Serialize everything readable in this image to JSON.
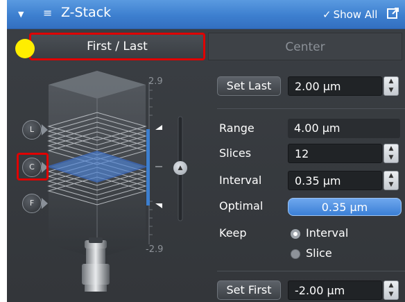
{
  "title_bar": {
    "title": "Z-Stack",
    "show_all_label": "Show All"
  },
  "tabs": {
    "first_last": "First / Last",
    "center": "Center"
  },
  "markers": {
    "last": "L",
    "center": "C",
    "first": "F"
  },
  "scale": {
    "top_value": "2.9",
    "bottom_value": "-2.9"
  },
  "set_last": {
    "label": "Set Last",
    "value": "2.00 µm"
  },
  "range": {
    "label": "Range",
    "value": "4.00 µm"
  },
  "slices": {
    "label": "Slices",
    "value": "12"
  },
  "interval": {
    "label": "Interval",
    "value": "0.35 µm"
  },
  "optimal": {
    "label": "Optimal",
    "value": "0.35 µm"
  },
  "keep": {
    "label": "Keep",
    "options": [
      "Interval",
      "Slice"
    ],
    "selected": "Interval"
  },
  "set_first": {
    "label": "Set First",
    "value": "-2.00 µm"
  },
  "colors": {
    "accent_blue": "#3d7fcf",
    "highlight_red": "#e00000",
    "indicator_yellow": "#ffee00"
  }
}
